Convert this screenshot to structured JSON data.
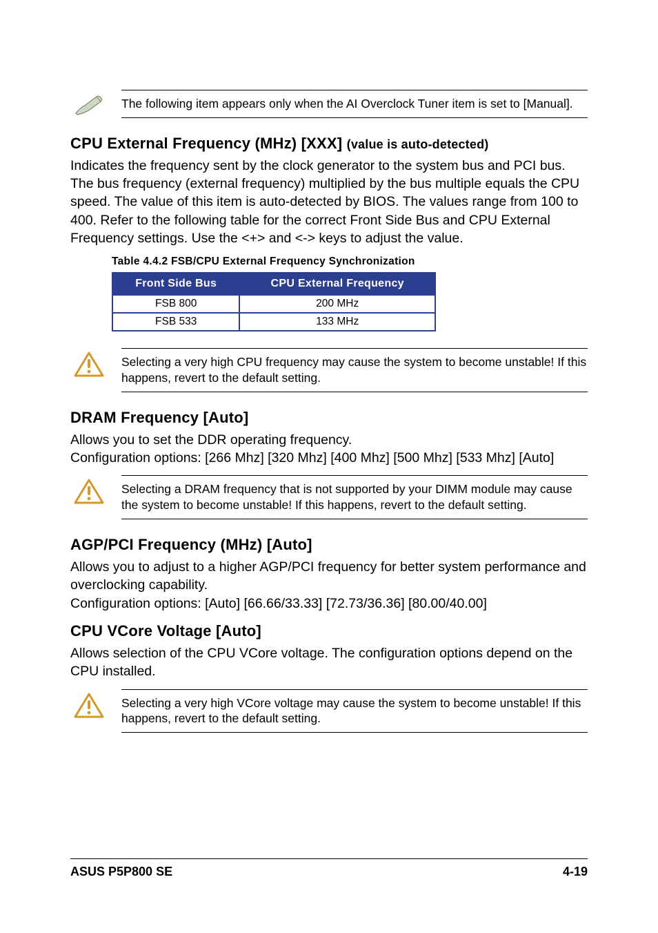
{
  "note1": "The following item appears only when the AI Overclock Tuner item is set to [Manual].",
  "sec1": {
    "title_main": "CPU External Frequency (MHz) [XXX]",
    "title_sub": "(value is auto-detected)",
    "body": "Indicates the frequency sent by the clock generator to the system bus and PCI bus. The bus frequency (external frequency) multiplied by the bus multiple equals the CPU speed. The value of this item is auto-detected by BIOS. The values range from 100 to 400. Refer to the following table for the correct Front Side Bus and CPU External Frequency settings. Use the <+> and <-> keys to adjust the value."
  },
  "table": {
    "caption": "Table 4.4.2 FSB/CPU External Frequency Synchronization",
    "h1": "Front Side Bus",
    "h2": "CPU External Frequency",
    "rows": [
      {
        "c1": "FSB 800",
        "c2": "200 MHz"
      },
      {
        "c1": "FSB 533",
        "c2": "133 MHz"
      }
    ]
  },
  "note2": "Selecting a very high CPU frequency may cause the system to become unstable! If this happens, revert to the default setting.",
  "sec2": {
    "title": "DRAM Frequency [Auto]",
    "body": "Allows you to set the DDR operating frequency.\nConfiguration options: [266 Mhz] [320 Mhz] [400 Mhz] [500 Mhz] [533 Mhz] [Auto]"
  },
  "note3": "Selecting a DRAM frequency that is not supported by your DIMM module may cause the system to become unstable! If this happens, revert to the default setting.",
  "sec3": {
    "title": "AGP/PCI Frequency (MHz) [Auto]",
    "body": "Allows you to adjust to a higher AGP/PCI frequency for better system performance and overclocking capability.\nConfiguration options: [Auto] [66.66/33.33] [72.73/36.36] [80.00/40.00]"
  },
  "sec4": {
    "title": "CPU VCore Voltage [Auto]",
    "body": "Allows selection of the CPU VCore voltage. The configuration options depend on the CPU installed."
  },
  "note4": "Selecting a very high VCore voltage may cause the system to become unstable! If this happens, revert to the default setting.",
  "footer": {
    "left": "ASUS P5P800 SE",
    "right": "4-19"
  }
}
